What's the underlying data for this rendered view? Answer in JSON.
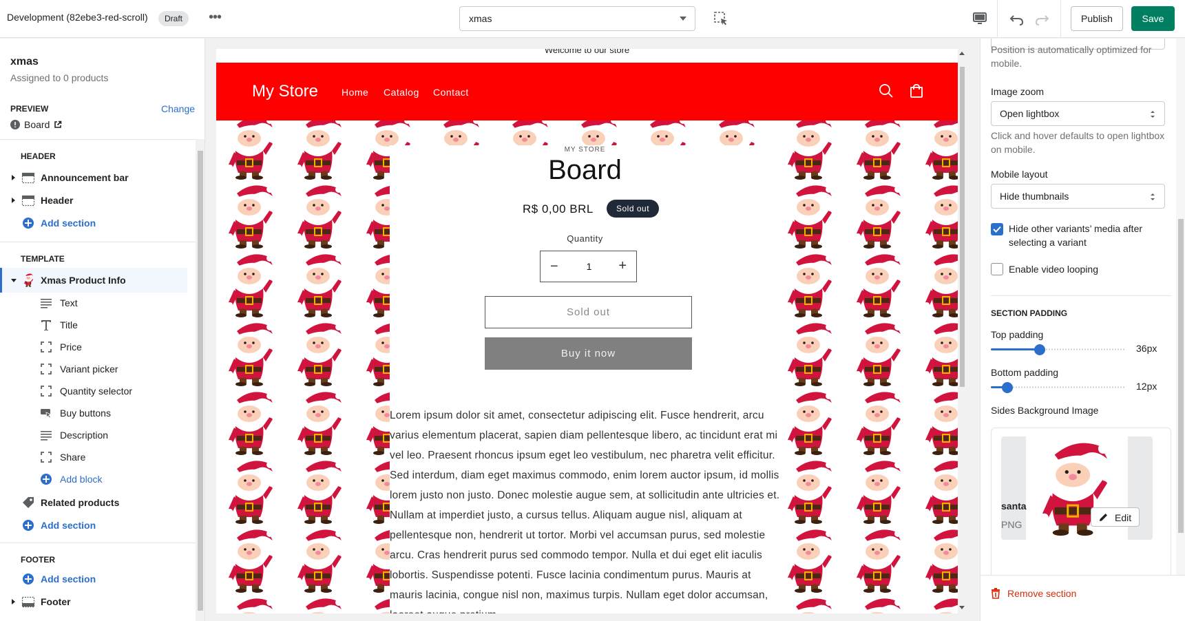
{
  "topbar": {
    "title": "Development (82ebe3-red-scroll)",
    "badge": "Draft",
    "template_select": "xmas",
    "publish_label": "Publish",
    "save_label": "Save"
  },
  "left_panel": {
    "template_name": "xmas",
    "assigned": "Assigned to 0 products",
    "preview_label": "PREVIEW",
    "change_label": "Change",
    "preview_product": "Board",
    "header_group": "HEADER",
    "header_sections": [
      {
        "label": "Announcement bar"
      },
      {
        "label": "Header"
      }
    ],
    "add_section": "Add section",
    "template_group": "TEMPLATE",
    "template_section": "Xmas Product Info",
    "blocks": [
      {
        "label": "Text",
        "icon": "text-icon"
      },
      {
        "label": "Title",
        "icon": "title-icon"
      },
      {
        "label": "Price",
        "icon": "block-icon"
      },
      {
        "label": "Variant picker",
        "icon": "block-icon"
      },
      {
        "label": "Quantity selector",
        "icon": "block-icon"
      },
      {
        "label": "Buy buttons",
        "icon": "buy-buttons-icon"
      },
      {
        "label": "Description",
        "icon": "text-icon"
      },
      {
        "label": "Share",
        "icon": "block-icon"
      }
    ],
    "add_block": "Add block",
    "related_products": "Related products",
    "footer_group": "FOOTER",
    "footer_section": "Footer"
  },
  "preview": {
    "announcement": "Welcome to our store",
    "store_name": "My Store",
    "nav": [
      "Home",
      "Catalog",
      "Contact"
    ],
    "vendor": "MY STORE",
    "product_title": "Board",
    "price": "R$ 0,00 BRL",
    "sold_out_badge": "Sold out",
    "quantity_label": "Quantity",
    "quantity_value": "1",
    "sold_out_button": "Sold out",
    "buy_now": "Buy it now",
    "description": "Lorem ipsum dolor sit amet, consectetur adipiscing elit. Fusce hendrerit, arcu varius elementum placerat, sapien diam pellentesque libero, ac tincidunt erat mi vel leo. Praesent rhoncus ipsum eget leo vestibulum, nec pharetra velit efficitur. Sed interdum, diam eget maximus commodo, enim lorem auctor ipsum, id mollis lorem justo non justo. Donec molestie augue sem, at sollicitudin ante ultricies et. Nullam at imperdiet justo, a cursus tellus. Aliquam augue nisl, aliquam at pellentesque non, hendrerit ut tortor. Morbi vel accumsan purus, sed molestie arcu. Cras hendrerit purus sed commodo tempor. Nulla et dui eget elit iaculis lobortis. Suspendisse potenti. Fusce lacinia condimentum purus. Mauris at mauris lacinia, congue nisl non, maximus turpis. Nullam eget dolor accumsan, laoreet augue pretium,",
    "header_color": "#ff0000"
  },
  "right_panel": {
    "position_help": "Position is automatically optimized for mobile.",
    "image_zoom_label": "Image zoom",
    "image_zoom_value": "Open lightbox",
    "image_zoom_help": "Click and hover defaults to open lightbox on mobile.",
    "mobile_layout_label": "Mobile layout",
    "mobile_layout_value": "Hide thumbnails",
    "hide_variants_label": "Hide other variants’ media after selecting a variant",
    "hide_variants_checked": true,
    "video_loop_label": "Enable video looping",
    "video_loop_checked": false,
    "section_padding": "SECTION PADDING",
    "top_padding_label": "Top padding",
    "top_padding_value": "36px",
    "top_padding_fraction": 0.36,
    "bottom_padding_label": "Bottom padding",
    "bottom_padding_value": "12px",
    "bottom_padding_fraction": 0.12,
    "sides_bg_label": "Sides Background Image",
    "image_name": "santa",
    "image_type": "PNG",
    "edit_label": "Edit",
    "remove_section": "Remove section"
  }
}
